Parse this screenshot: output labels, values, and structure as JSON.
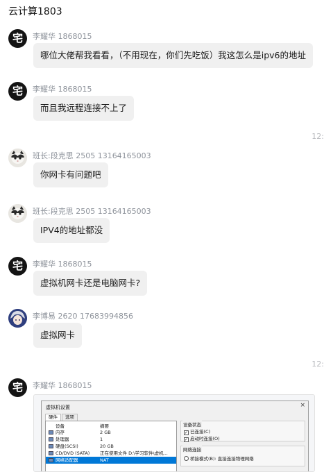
{
  "chat": {
    "title": "云计算1803"
  },
  "messages": [
    {
      "sender": "李耀华 1868015",
      "avatar": "宅",
      "text": "哪位大佬帮我看看，（不用现在，你们先吃饭）我这怎么是ipv6的地址"
    },
    {
      "sender": "李耀华 1868015",
      "avatar": "宅",
      "text": "而且我远程连接不上了"
    },
    {
      "sender": "班长:段克思 2505 13164165003",
      "avatar": "cat",
      "text": "你网卡有问题吧"
    },
    {
      "sender": "班长:段克思 2505 13164165003",
      "avatar": "cat",
      "text": "IPV4的地址都没"
    },
    {
      "sender": "李耀华 1868015",
      "avatar": "宅",
      "text": "虚拟机网卡还是电脑网卡?"
    },
    {
      "sender": "李博易 2620 17683994856",
      "avatar": "anime",
      "text": "虚拟网卡"
    },
    {
      "sender": "李耀华 1868015",
      "avatar": "宅",
      "text": ""
    }
  ],
  "timestamps": [
    "12:",
    "12:"
  ],
  "vm_dialog": {
    "title": "虚拟机设置",
    "close_glyph": "×",
    "tabs": [
      "硬件",
      "选项"
    ],
    "col_device": "设备",
    "col_summary": "摘要",
    "rows": [
      {
        "device": "内存",
        "summary": "2 GB"
      },
      {
        "device": "处理器",
        "summary": "1"
      },
      {
        "device": "硬盘(SCSI)",
        "summary": "20 GB"
      },
      {
        "device": "CD/DVD (SATA)",
        "summary": "正在使用文件 D:\\学习软件\\虚机..."
      },
      {
        "device": "网络适配器",
        "summary": "NAT"
      }
    ],
    "device_status": {
      "title": "设备状态",
      "connected": "已连接(C)",
      "connect_on_start": "启动时连接(O)"
    },
    "network": {
      "title": "网络连接",
      "bridged": "桥接模式(B): 直接连接物理网络"
    }
  },
  "colors": {
    "bubble": "#f0f0f0",
    "sender": "#8e939b",
    "selection": "#0078d7"
  }
}
